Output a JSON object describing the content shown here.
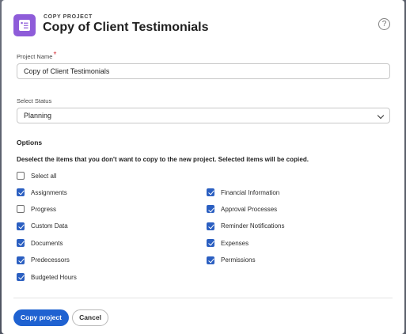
{
  "dialog": {
    "eyebrow": "COPY PROJECT",
    "title": "Copy of Client Testimonials",
    "help_glyph": "?",
    "icon": "project-icon"
  },
  "form": {
    "name_label": "Project Name",
    "required_mark": "*",
    "name_value": "Copy of Client Testimonials",
    "status_label": "Select Status",
    "status_value": "Planning"
  },
  "options": {
    "heading": "Options",
    "instructions": "Deselect the items that you don't want to copy to the new project. Selected items will be copied.",
    "select_all": {
      "label": "Select all",
      "checked": false
    },
    "left": [
      {
        "label": "Assignments",
        "checked": true
      },
      {
        "label": "Progress",
        "checked": false
      },
      {
        "label": "Custom Data",
        "checked": true
      },
      {
        "label": "Documents",
        "checked": true
      },
      {
        "label": "Predecessors",
        "checked": true
      },
      {
        "label": "Budgeted Hours",
        "checked": true
      }
    ],
    "right": [
      {
        "label": "Financial Information",
        "checked": true
      },
      {
        "label": "Approval Processes",
        "checked": true
      },
      {
        "label": "Reminder Notifications",
        "checked": true
      },
      {
        "label": "Expenses",
        "checked": true
      },
      {
        "label": "Permissions",
        "checked": true
      }
    ]
  },
  "footer": {
    "primary_label": "Copy project",
    "secondary_label": "Cancel"
  },
  "colors": {
    "accent": "#1f62d1",
    "checkbox": "#2b5fc1",
    "icon_bg": "#8e5cd9",
    "required": "#d7373f"
  }
}
